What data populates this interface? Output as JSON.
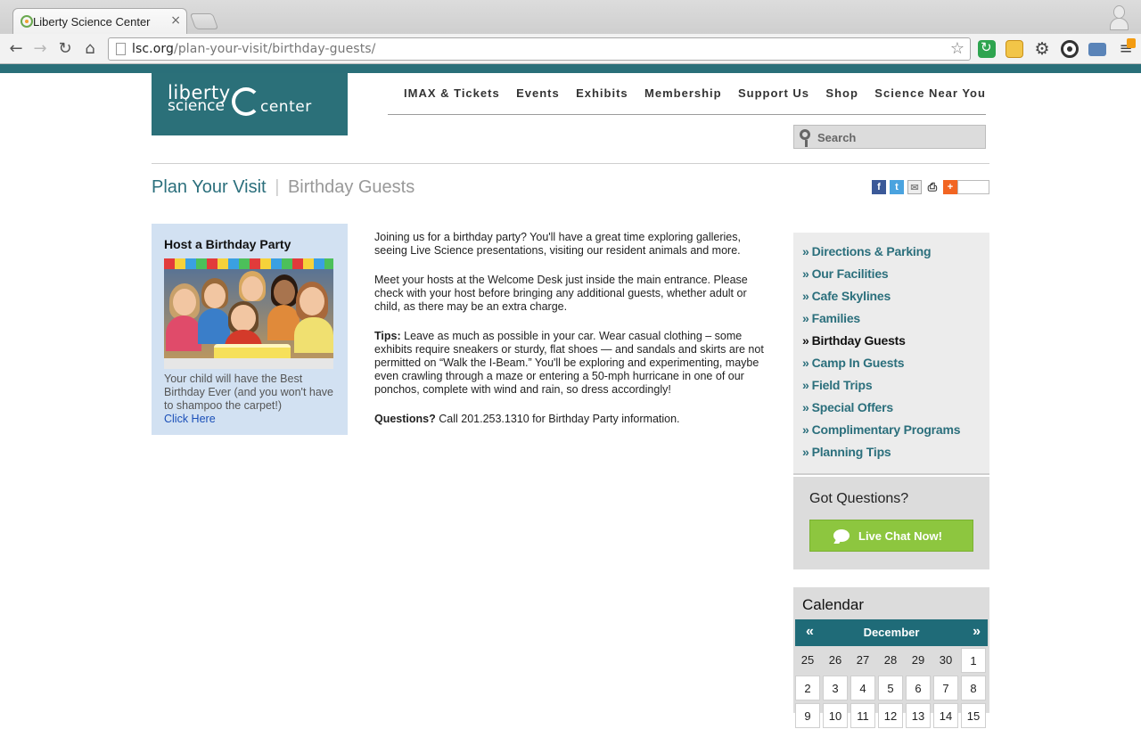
{
  "browser": {
    "tab_title": "Liberty Science Center",
    "url_host": "lsc.org",
    "url_path": "/plan-your-visit/birthday-guests/"
  },
  "site": {
    "logo": {
      "line1": "liberty",
      "line2": "science",
      "line3": "center"
    },
    "nav": [
      "IMAX & Tickets",
      "Events",
      "Exhibits",
      "Membership",
      "Support Us",
      "Shop",
      "Science Near You"
    ],
    "search_placeholder": "Search"
  },
  "breadcrumb": {
    "parent": "Plan Your Visit",
    "separator": "|",
    "current": "Birthday Guests"
  },
  "share_icons": [
    "facebook-icon",
    "twitter-icon",
    "email-icon",
    "print-icon",
    "addthis-icon"
  ],
  "promo": {
    "title": "Host a Birthday Party",
    "image_alt": "children at a birthday party",
    "text": "Your child will have the Best Birthday Ever (and you won't have to shampoo the carpet!)",
    "link": "Click Here"
  },
  "main": {
    "p1": "Joining us for a birthday party? You'll have a great time exploring galleries, seeing Live Science presentations, visiting our resident animals and more.",
    "p2": "Meet your hosts at the Welcome Desk just inside the main entrance. Please check with your host before bringing any additional guests, whether adult or child, as there may be an extra charge.",
    "p3_label": "Tips:",
    "p3": " Leave as much as possible in your car. Wear casual clothing – some exhibits require sneakers or sturdy, flat shoes — and sandals and skirts are not permitted on “Walk the I-Beam.” You'll be exploring and experimenting, maybe even crawling through a maze or entering a 50-mph hurricane in one of our ponchos, complete with wind and rain, so dress accordingly!",
    "p4_label": "Questions?",
    "p4": " Call 201.253.1310 for Birthday Party information."
  },
  "sidebar": {
    "items": [
      {
        "label": "Directions & Parking",
        "active": false
      },
      {
        "label": "Our Facilities",
        "active": false
      },
      {
        "label": "Cafe Skylines",
        "active": false
      },
      {
        "label": "Families",
        "active": false
      },
      {
        "label": "Birthday Guests",
        "active": true
      },
      {
        "label": "Camp In Guests",
        "active": false
      },
      {
        "label": "Field Trips",
        "active": false
      },
      {
        "label": "Special Offers",
        "active": false
      },
      {
        "label": "Complimentary Programs",
        "active": false
      },
      {
        "label": "Planning Tips",
        "active": false
      }
    ],
    "bullet": "»",
    "questions_title": "Got Questions?",
    "chat_button": "Live Chat Now!"
  },
  "calendar": {
    "title": "Calendar",
    "prev": "«",
    "month": "December",
    "next": "»",
    "row1": [
      "25",
      "26",
      "27",
      "28",
      "29",
      "30",
      "1"
    ],
    "row2": [
      "2",
      "3",
      "4",
      "5",
      "6",
      "7",
      "8"
    ],
    "row3": [
      "9",
      "10",
      "11",
      "12",
      "13",
      "14",
      "15"
    ]
  },
  "colors": {
    "brand_teal": "#2b7079",
    "link_teal": "#2b6f7c",
    "chat_green": "#8dc63f",
    "promo_blue": "#d2e1f2"
  }
}
